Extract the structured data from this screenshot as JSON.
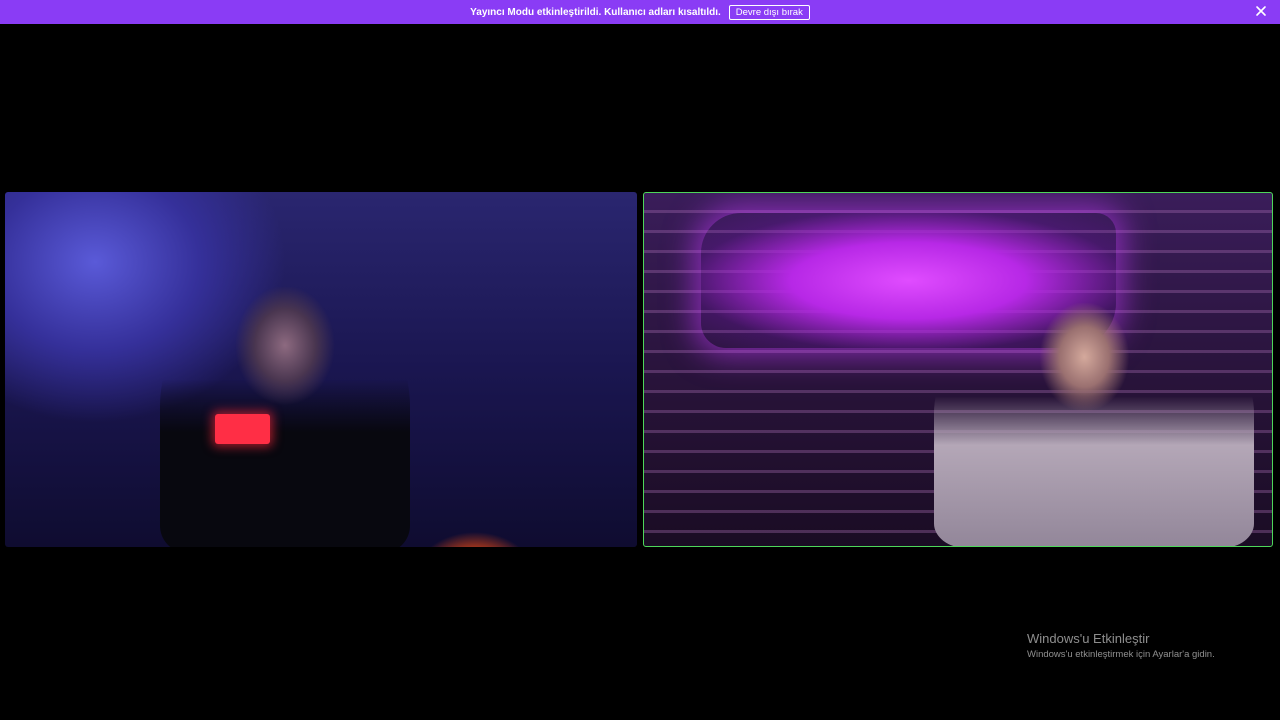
{
  "banner": {
    "message": "Yayıncı Modu etkinleştirildi. Kullanıcı adları kısaltıldı.",
    "disable_button": "Devre dışı bırak",
    "close_icon": "close-icon",
    "color": "#8a3cf5"
  },
  "video_tiles": [
    {
      "name": "participant-left",
      "speaking": false
    },
    {
      "name": "participant-right",
      "speaking": true,
      "highlight_color": "#4ed65a"
    }
  ],
  "watermark": {
    "title": "Windows'u Etkinleştir",
    "subtitle": "Windows'u etkinleştirmek için Ayarlar'a gidin."
  }
}
